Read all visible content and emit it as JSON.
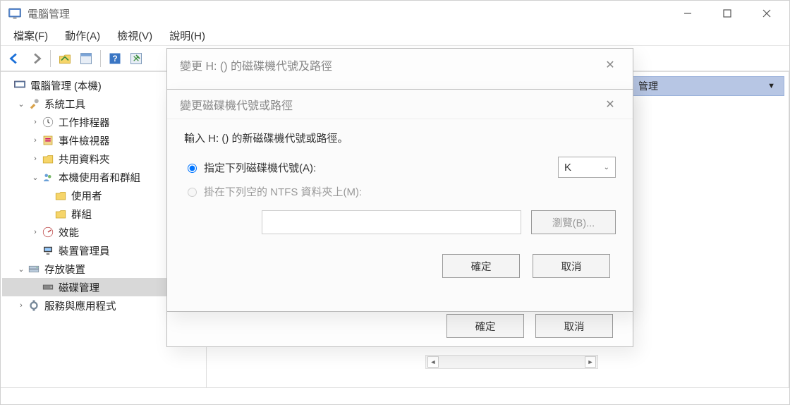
{
  "window": {
    "title": "電腦管理",
    "controls": {
      "min": "−",
      "max": "□",
      "close": "✕"
    }
  },
  "menubar": {
    "file": "檔案(F)",
    "action": "動作(A)",
    "view": "檢視(V)",
    "help": "說明(H)"
  },
  "toolbar": {
    "back": "←",
    "forward": "→"
  },
  "tree": {
    "root": "電腦管理 (本機)",
    "systools": "系統工具",
    "scheduler": "工作排程器",
    "eventvwr": "事件檢視器",
    "shares": "共用資料夾",
    "localusers": "本機使用者和群組",
    "users": "使用者",
    "groups": "群組",
    "perf": "效能",
    "devmgr": "裝置管理員",
    "storage": "存放裝置",
    "diskmgmt": "磁碟管理",
    "services": "服務與應用程式"
  },
  "actions": {
    "panel_title": "管理"
  },
  "dialog1": {
    "title": "變更 H: () 的磁碟機代號及路徑",
    "ok": "確定",
    "cancel": "取消"
  },
  "dialog2": {
    "title": "變更磁碟機代號或路徑",
    "prompt": "輸入 H: () 的新磁碟機代號或路徑。",
    "opt_assign": "指定下列磁碟機代號(A):",
    "opt_mount": "掛在下列空的 NTFS 資料夾上(M):",
    "letter": "K",
    "browse": "瀏覽(B)...",
    "path_value": "",
    "ok": "確定",
    "cancel": "取消"
  }
}
